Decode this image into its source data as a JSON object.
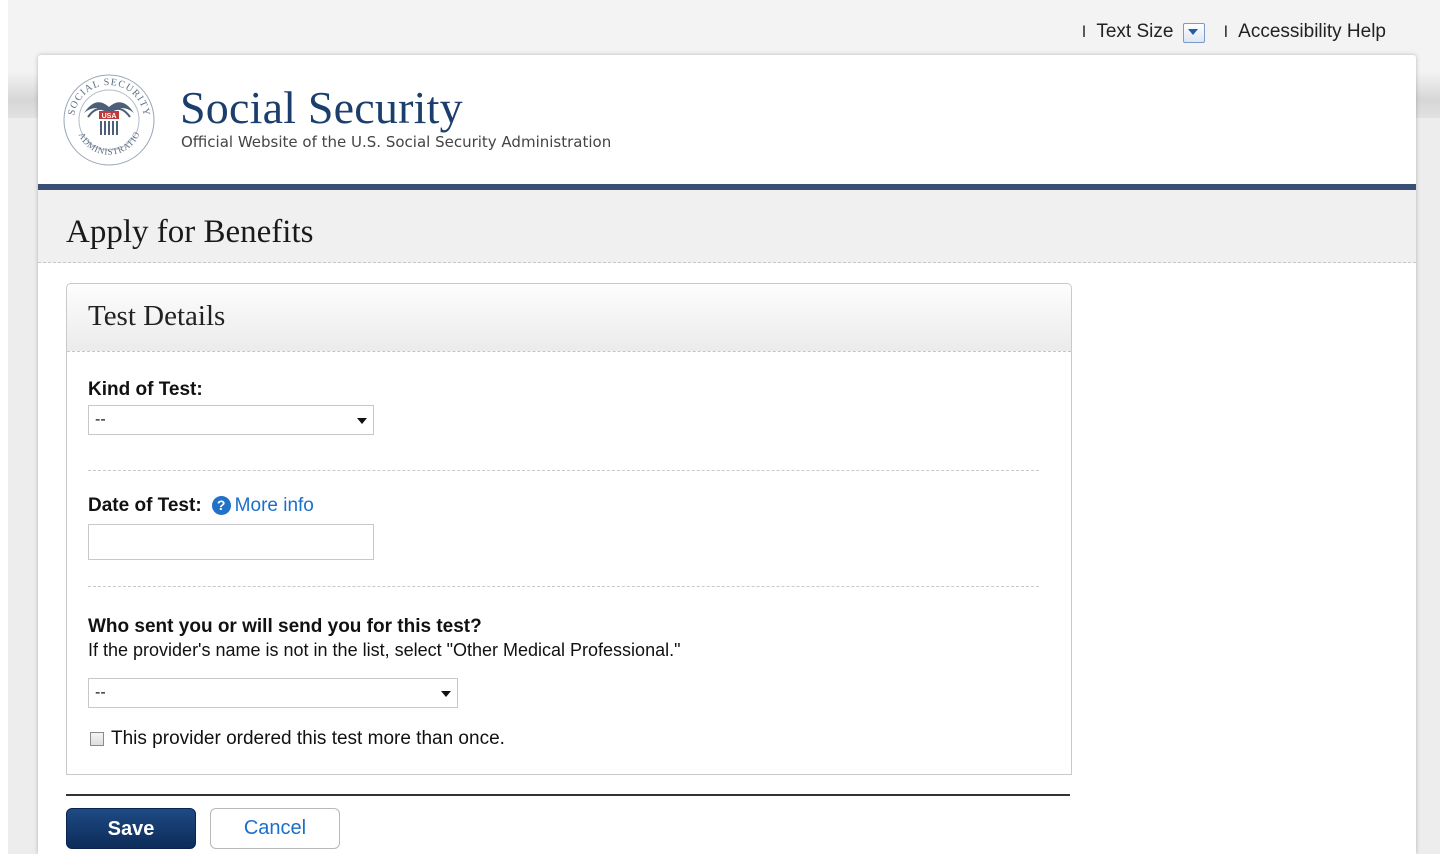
{
  "utility_bar": {
    "text_size_label": "Text Size",
    "accessibility_label": "Accessibility Help",
    "separator": "I"
  },
  "header": {
    "title": "Social Security",
    "subtitle": "Official Website of the U.S. Social Security Administration",
    "seal_text": "SOCIAL SECURITY ADMINISTRATION",
    "seal_usa": "USA"
  },
  "page": {
    "title": "Apply for Benefits"
  },
  "panel": {
    "title": "Test Details",
    "kind_of_test": {
      "label": "Kind of Test:",
      "selected": "--"
    },
    "date_of_test": {
      "label": "Date of Test:",
      "help_glyph": "?",
      "more_info": "More info",
      "value": ""
    },
    "who_sent": {
      "label": "Who sent you or will send you for this test?",
      "hint": "If the provider's name is not in the list, select \"Other Medical Professional.\"",
      "selected": "--"
    },
    "multiple_checkbox": {
      "label": "This provider ordered this test more than once.",
      "checked": false
    }
  },
  "buttons": {
    "save": "Save",
    "cancel": "Cancel"
  },
  "colors": {
    "brand_navy": "#1c3e6d",
    "header_rule": "#3a4f73",
    "link_blue": "#1a6fc9"
  }
}
